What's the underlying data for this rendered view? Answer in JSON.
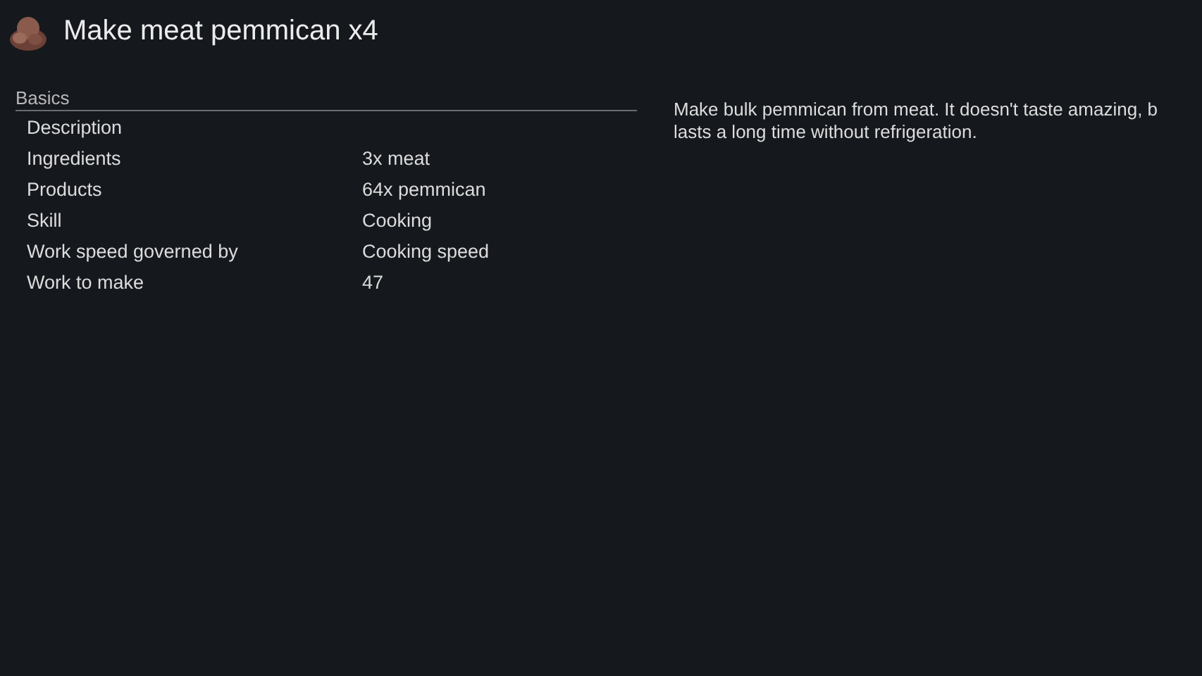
{
  "title": "Make meat pemmican x4",
  "section": "Basics",
  "rows": [
    {
      "label": "Description"
    },
    {
      "label": "Ingredients",
      "value": "3x meat"
    },
    {
      "label": "Products",
      "value": "64x pemmican"
    },
    {
      "label": "Skill",
      "value": "Cooking"
    },
    {
      "label": "Work speed governed by",
      "value": "Cooking speed"
    },
    {
      "label": "Work to make",
      "value": "47"
    }
  ],
  "description_lines": [
    "Make bulk pemmican from meat. It doesn't taste amazing, b",
    "lasts a long time without refrigeration."
  ]
}
